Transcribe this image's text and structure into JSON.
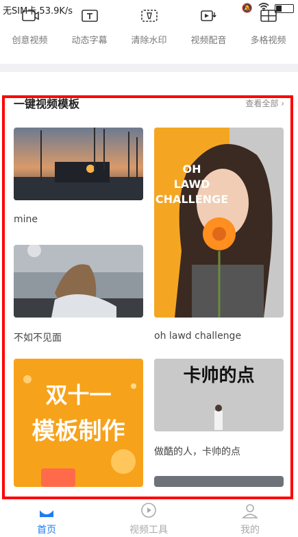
{
  "status_bar": {
    "carrier_speed": "无SIM卡 53.9K/s"
  },
  "tools": [
    {
      "label": "创意视频",
      "icon": "creative-video-icon"
    },
    {
      "label": "动态字幕",
      "icon": "dynamic-subtitle-icon"
    },
    {
      "label": "清除水印",
      "icon": "remove-watermark-icon"
    },
    {
      "label": "视频配音",
      "icon": "video-dubbing-icon"
    },
    {
      "label": "多格视频",
      "icon": "multi-grid-video-icon"
    }
  ],
  "section": {
    "title": "一键视频模板",
    "see_all": "查看全部 ›"
  },
  "templates": [
    {
      "caption": "mine"
    },
    {
      "caption": "oh lawd challenge",
      "overlay": "OH\nLAWD\nCHALLENGE"
    },
    {
      "caption": "不如不见面"
    },
    {
      "caption": "",
      "overlay_line1": "双十一",
      "overlay_line2": "模板制作"
    },
    {
      "caption": "做酷的人，卡帅的点",
      "overlay": "卡帅的点"
    }
  ],
  "bottom_nav": [
    {
      "label": "首页",
      "active": true,
      "color": "#1e7cf2"
    },
    {
      "label": "视频工具",
      "active": false,
      "color": "#aaaaaa"
    },
    {
      "label": "我的",
      "active": false,
      "color": "#aaaaaa"
    }
  ],
  "colors": {
    "accent": "#1e7cf2",
    "highlight_frame": "#ff0000"
  }
}
